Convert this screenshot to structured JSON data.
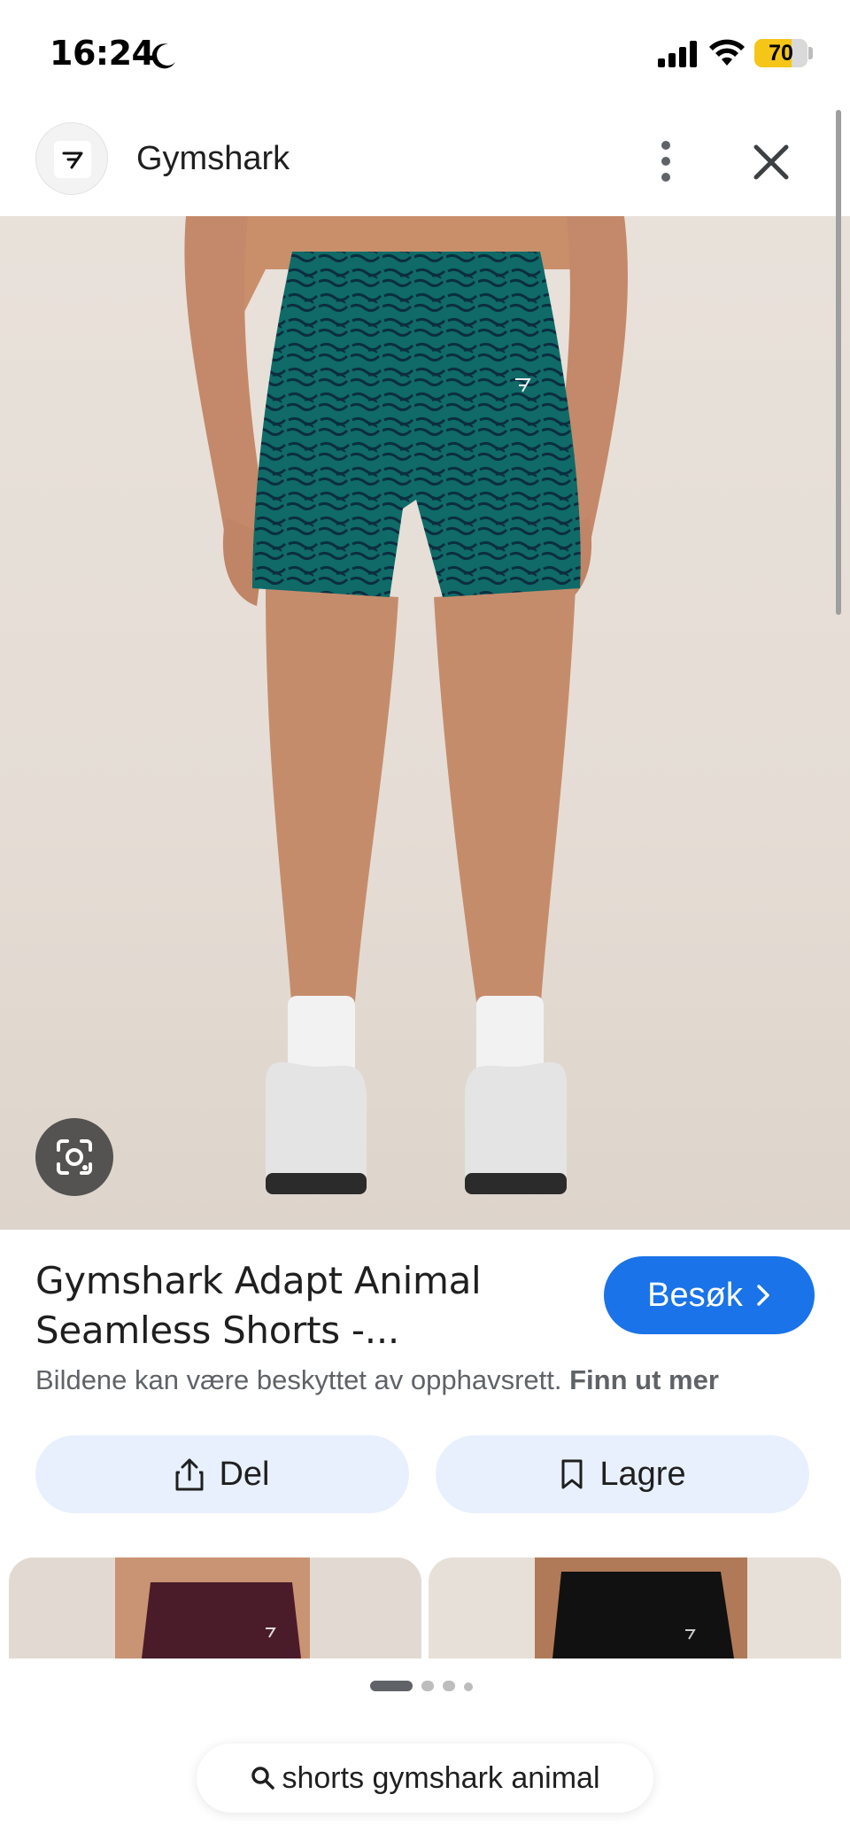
{
  "status_bar": {
    "time": "16:24",
    "battery": "70",
    "battery_level": 0.7
  },
  "header": {
    "site_name": "Gymshark"
  },
  "product": {
    "title": "Gymshark Adapt Animal Seamless Shorts -...",
    "visit_label": "Besøk",
    "copyright_text": "Bildene kan være beskyttet av opphavsrett.",
    "learn_more": "Finn ut mer"
  },
  "actions": {
    "share_label": "Del",
    "save_label": "Lagre"
  },
  "pagination": {
    "pages": 4,
    "current": 1
  },
  "search": {
    "query": "shorts gymshark animal"
  },
  "colors": {
    "accent": "#1a73e8",
    "chip_bg": "#e8f0fe",
    "battery": "#f5c518",
    "shorts": "#0f5e5e"
  }
}
